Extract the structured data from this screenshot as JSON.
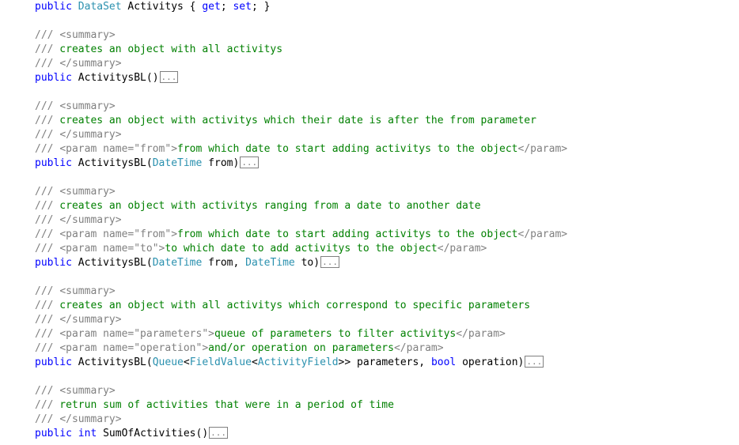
{
  "lines": [
    [
      {
        "cls": "kw",
        "t": "public"
      },
      {
        "cls": "txt",
        "t": " "
      },
      {
        "cls": "type",
        "t": "DataSet"
      },
      {
        "cls": "txt",
        "t": " Activitys { "
      },
      {
        "cls": "kw",
        "t": "get"
      },
      {
        "cls": "txt",
        "t": "; "
      },
      {
        "cls": "kw",
        "t": "set"
      },
      {
        "cls": "txt",
        "t": "; }"
      }
    ],
    [],
    [
      {
        "cls": "tag",
        "t": "///"
      },
      {
        "cls": "cm",
        "t": " "
      },
      {
        "cls": "tag",
        "t": "<summary>"
      }
    ],
    [
      {
        "cls": "tag",
        "t": "///"
      },
      {
        "cls": "cm",
        "t": " creates an object with all activitys"
      }
    ],
    [
      {
        "cls": "tag",
        "t": "///"
      },
      {
        "cls": "cm",
        "t": " "
      },
      {
        "cls": "tag",
        "t": "</summary>"
      }
    ],
    [
      {
        "cls": "kw",
        "t": "public"
      },
      {
        "cls": "txt",
        "t": " ActivitysBL()"
      },
      {
        "cls": "collapse",
        "t": "..."
      }
    ],
    [],
    [
      {
        "cls": "tag",
        "t": "///"
      },
      {
        "cls": "cm",
        "t": " "
      },
      {
        "cls": "tag",
        "t": "<summary>"
      }
    ],
    [
      {
        "cls": "tag",
        "t": "///"
      },
      {
        "cls": "cm",
        "t": " creates an object with activitys which their date is after the from parameter"
      }
    ],
    [
      {
        "cls": "tag",
        "t": "///"
      },
      {
        "cls": "cm",
        "t": " "
      },
      {
        "cls": "tag",
        "t": "</summary>"
      }
    ],
    [
      {
        "cls": "tag",
        "t": "///"
      },
      {
        "cls": "cm",
        "t": " "
      },
      {
        "cls": "tag",
        "t": "<param name=\"from\">"
      },
      {
        "cls": "cm",
        "t": "from which date to start adding activitys to the object"
      },
      {
        "cls": "tag",
        "t": "</param>"
      }
    ],
    [
      {
        "cls": "kw",
        "t": "public"
      },
      {
        "cls": "txt",
        "t": " ActivitysBL("
      },
      {
        "cls": "type",
        "t": "DateTime"
      },
      {
        "cls": "txt",
        "t": " from)"
      },
      {
        "cls": "collapse",
        "t": "..."
      }
    ],
    [],
    [
      {
        "cls": "tag",
        "t": "///"
      },
      {
        "cls": "cm",
        "t": " "
      },
      {
        "cls": "tag",
        "t": "<summary>"
      }
    ],
    [
      {
        "cls": "tag",
        "t": "///"
      },
      {
        "cls": "cm",
        "t": " creates an object with activitys ranging from a date to another date"
      }
    ],
    [
      {
        "cls": "tag",
        "t": "///"
      },
      {
        "cls": "cm",
        "t": " "
      },
      {
        "cls": "tag",
        "t": "</summary>"
      }
    ],
    [
      {
        "cls": "tag",
        "t": "///"
      },
      {
        "cls": "cm",
        "t": " "
      },
      {
        "cls": "tag",
        "t": "<param name=\"from\">"
      },
      {
        "cls": "cm",
        "t": "from which date to start adding activitys to the object"
      },
      {
        "cls": "tag",
        "t": "</param>"
      }
    ],
    [
      {
        "cls": "tag",
        "t": "///"
      },
      {
        "cls": "cm",
        "t": " "
      },
      {
        "cls": "tag",
        "t": "<param name=\"to\">"
      },
      {
        "cls": "cm",
        "t": "to which date to add activitys to the object"
      },
      {
        "cls": "tag",
        "t": "</param>"
      }
    ],
    [
      {
        "cls": "kw",
        "t": "public"
      },
      {
        "cls": "txt",
        "t": " ActivitysBL("
      },
      {
        "cls": "type",
        "t": "DateTime"
      },
      {
        "cls": "txt",
        "t": " from, "
      },
      {
        "cls": "type",
        "t": "DateTime"
      },
      {
        "cls": "txt",
        "t": " to)"
      },
      {
        "cls": "collapse",
        "t": "..."
      }
    ],
    [],
    [
      {
        "cls": "tag",
        "t": "///"
      },
      {
        "cls": "cm",
        "t": " "
      },
      {
        "cls": "tag",
        "t": "<summary>"
      }
    ],
    [
      {
        "cls": "tag",
        "t": "///"
      },
      {
        "cls": "cm",
        "t": " creates an object with all activitys which correspond to specific parameters"
      }
    ],
    [
      {
        "cls": "tag",
        "t": "///"
      },
      {
        "cls": "cm",
        "t": " "
      },
      {
        "cls": "tag",
        "t": "</summary>"
      }
    ],
    [
      {
        "cls": "tag",
        "t": "///"
      },
      {
        "cls": "cm",
        "t": " "
      },
      {
        "cls": "tag",
        "t": "<param name=\"parameters\">"
      },
      {
        "cls": "cm",
        "t": "queue of parameters to filter activitys"
      },
      {
        "cls": "tag",
        "t": "</param>"
      }
    ],
    [
      {
        "cls": "tag",
        "t": "///"
      },
      {
        "cls": "cm",
        "t": " "
      },
      {
        "cls": "tag",
        "t": "<param name=\"operation\">"
      },
      {
        "cls": "cm",
        "t": "and/or operation on parameters"
      },
      {
        "cls": "tag",
        "t": "</param>"
      }
    ],
    [
      {
        "cls": "kw",
        "t": "public"
      },
      {
        "cls": "txt",
        "t": " ActivitysBL("
      },
      {
        "cls": "type",
        "t": "Queue"
      },
      {
        "cls": "txt",
        "t": "<"
      },
      {
        "cls": "type",
        "t": "FieldValue"
      },
      {
        "cls": "txt",
        "t": "<"
      },
      {
        "cls": "type",
        "t": "ActivityField"
      },
      {
        "cls": "txt",
        "t": ">> parameters, "
      },
      {
        "cls": "kw",
        "t": "bool"
      },
      {
        "cls": "txt",
        "t": " operation)"
      },
      {
        "cls": "collapse",
        "t": "..."
      }
    ],
    [],
    [
      {
        "cls": "tag",
        "t": "///"
      },
      {
        "cls": "cm",
        "t": " "
      },
      {
        "cls": "tag",
        "t": "<summary>"
      }
    ],
    [
      {
        "cls": "tag",
        "t": "///"
      },
      {
        "cls": "cm",
        "t": " retrun sum of activities that were in a period of time"
      }
    ],
    [
      {
        "cls": "tag",
        "t": "///"
      },
      {
        "cls": "cm",
        "t": " "
      },
      {
        "cls": "tag",
        "t": "</summary>"
      }
    ],
    [
      {
        "cls": "kw",
        "t": "public"
      },
      {
        "cls": "txt",
        "t": " "
      },
      {
        "cls": "kw",
        "t": "int"
      },
      {
        "cls": "txt",
        "t": " SumOfActivities()"
      },
      {
        "cls": "collapse",
        "t": "..."
      }
    ]
  ],
  "colors": {
    "keyword": "#0000ff",
    "type": "#2b91af",
    "comment": "#008000",
    "doc_tag": "#808080",
    "background": "#ffffff"
  }
}
